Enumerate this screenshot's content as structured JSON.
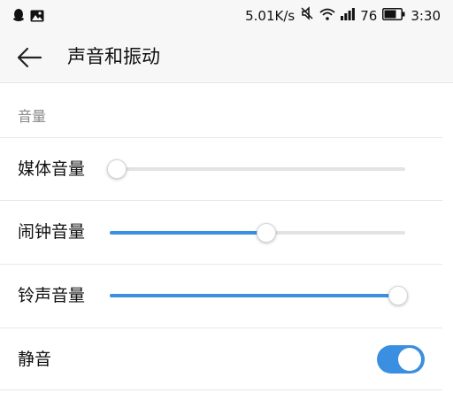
{
  "status_bar": {
    "network_speed": "5.01K/s",
    "battery_level": "76",
    "time": "3:30",
    "icons": [
      "qq-icon",
      "image-icon",
      "mute-icon",
      "wifi-icon",
      "signal-icon",
      "battery-icon"
    ]
  },
  "app_bar": {
    "title": "声音和振动",
    "back_icon": "back-arrow-icon"
  },
  "section": {
    "title": "音量"
  },
  "settings": [
    {
      "label": "媒体音量",
      "level": 0.02
    },
    {
      "label": "闹钟音量",
      "level": 0.53
    },
    {
      "label": "铃声音量",
      "level": 0.98
    }
  ],
  "mute": {
    "label": "静音",
    "enabled": true
  },
  "colors": {
    "accent": "#3a8fe0",
    "track": "#e3e3e3",
    "background": "#ffffff",
    "bar_background": "#f7f7f7"
  }
}
